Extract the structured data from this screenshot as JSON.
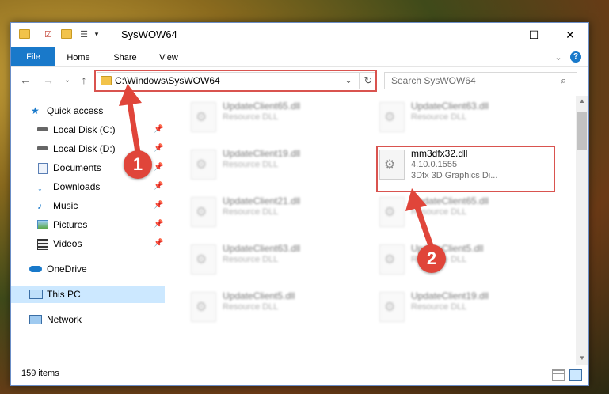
{
  "window": {
    "title": "SysWOW64"
  },
  "window_controls": {
    "minimize": "—",
    "maximize": "☐",
    "close": "✕"
  },
  "ribbon": {
    "tabs": [
      "File",
      "Home",
      "Share",
      "View"
    ],
    "expand": "⌄",
    "help": "?"
  },
  "address": {
    "path": "C:\\Windows\\SysWOW64",
    "dropdown": "⌄",
    "refresh": "↻"
  },
  "nav_buttons": {
    "back": "←",
    "forward": "→",
    "recent": "⌄",
    "up": "↑"
  },
  "search": {
    "placeholder": "Search SysWOW64",
    "icon": "⌕"
  },
  "sidebar": {
    "items": [
      {
        "label": "Quick access",
        "icon": "star-icon",
        "pinned": false
      },
      {
        "label": "Local Disk (C:)",
        "icon": "drive-icon",
        "pinned": true
      },
      {
        "label": "Local Disk (D:)",
        "icon": "drive-icon",
        "pinned": true
      },
      {
        "label": "Documents",
        "icon": "documents-icon",
        "pinned": true
      },
      {
        "label": "Downloads",
        "icon": "download-icon",
        "pinned": true
      },
      {
        "label": "Music",
        "icon": "music-icon",
        "pinned": true
      },
      {
        "label": "Pictures",
        "icon": "pictures-icon",
        "pinned": true
      },
      {
        "label": "Videos",
        "icon": "videos-icon",
        "pinned": true
      },
      {
        "label": "OneDrive",
        "icon": "cloud-icon",
        "pinned": false
      },
      {
        "label": "This PC",
        "icon": "pc-icon",
        "pinned": false
      },
      {
        "label": "Network",
        "icon": "network-icon",
        "pinned": false
      }
    ],
    "pin_glyph": "📌"
  },
  "files": [
    {
      "name": "UpdateClient65.dll",
      "type": "Resource DLL"
    },
    {
      "name": "UpdateClient63.dll",
      "type": "Resource DLL"
    },
    {
      "name": "UpdateClient19.dll",
      "type": "Resource DLL"
    },
    {
      "name": "mm3dfx32.dll",
      "version": "4.10.0.1555",
      "description": "3Dfx 3D Graphics Di..."
    },
    {
      "name": "UpdateClient21.dll",
      "type": "Resource DLL"
    },
    {
      "name": "UpdateClient65.dll",
      "type": "Resource DLL"
    },
    {
      "name": "UpdateClient63.dll",
      "type": "Resource DLL"
    },
    {
      "name": "UpdateClient5.dll",
      "type": "Resource DLL"
    },
    {
      "name": "UpdateClient5.dll",
      "type": "Resource DLL"
    },
    {
      "name": "UpdateClient19.dll",
      "type": "Resource DLL"
    }
  ],
  "status": {
    "count": "159 items"
  },
  "annotations": {
    "step1": "1",
    "step2": "2"
  },
  "colors": {
    "highlight": "#d9534f",
    "badge": "#e0453a",
    "file_tab": "#1979ca",
    "selected": "#cce8ff"
  }
}
